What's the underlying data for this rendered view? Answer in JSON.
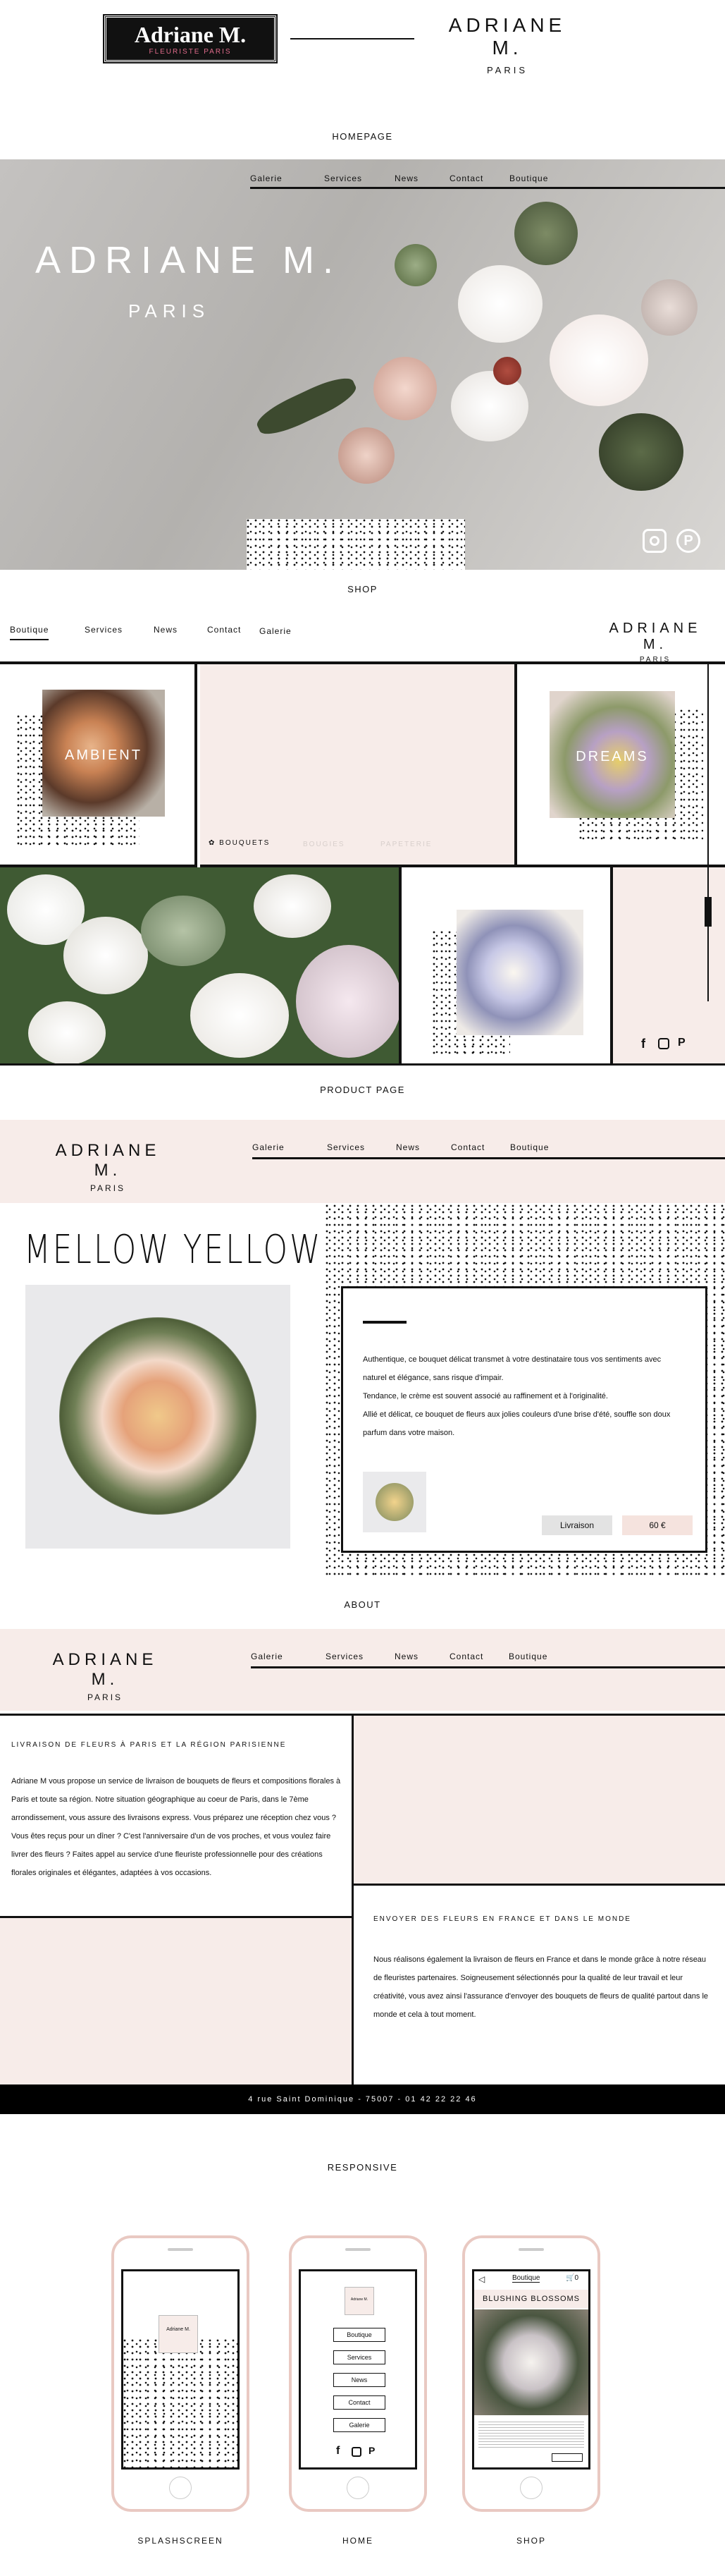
{
  "logos": {
    "left_main": "Adriane M.",
    "left_sub": "FLEURISTE PARIS",
    "right_main": "ADRIANE M.",
    "right_sub": "PARIS"
  },
  "sections": {
    "homepage": "HOMEPAGE",
    "shop": "SHOP",
    "product": "PRODUCT PAGE",
    "about": "ABOUT",
    "responsive": "RESPONSIVE"
  },
  "nav": {
    "items": [
      "Galerie",
      "Services",
      "News",
      "Contact",
      "Boutique"
    ]
  },
  "hero": {
    "title": "ADRIANE M.",
    "subtitle": "PARIS"
  },
  "shop": {
    "nav": [
      "Boutique",
      "Services",
      "News",
      "Contact",
      "Galerie"
    ],
    "tile_ambient": "AMBIENT",
    "tile_dreams": "DREAMS",
    "categories": [
      "BOUQUETS",
      "BOUGIES",
      "PAPETERIE"
    ]
  },
  "product": {
    "title": "MELLOW YELLOW",
    "desc1": "Authentique, ce bouquet délicat transmet à votre destinataire tous vos sentiments avec naturel et élégance, sans risque d'impair.",
    "desc2": "Tendance, le crème est souvent associé au raffinement et à l'originalité.",
    "desc3": "Allié et délicat, ce bouquet de fleurs aux jolies couleurs d'une brise d'été, souffle son doux parfum dans votre maison.",
    "delivery_label": "Livraison",
    "price": "60 €"
  },
  "about": {
    "heading1": "LIVRAISON DE FLEURS À PARIS ET LA RÉGION PARISIENNE",
    "para1": "Adriane M vous propose un service de livraison de bouquets de fleurs et compositions florales à Paris et toute sa région. Notre situation géographique au coeur de Paris, dans le 7ème arrondissement, vous assure des livraisons express. Vous préparez une réception chez vous ? Vous êtes reçus pour un dîner ? C'est l'anniversaire d'un de vos proches, et vous voulez faire livrer des fleurs ? Faites appel au service d'une fleuriste professionnelle pour des créations florales originales et élégantes, adaptées à vos occasions.",
    "heading2": "ENVOYER DES FLEURS EN FRANCE ET DANS LE MONDE",
    "para2": "Nous réalisons également la livraison de fleurs en France et dans le monde grâce à notre réseau de fleuristes partenaires. Soigneusement sélectionnés pour la qualité de leur travail et leur créativité, vous avez ainsi l'assurance d'envoyer des bouquets de fleurs de qualité partout dans le monde et cela à tout moment."
  },
  "footer": {
    "address": "4 rue Saint Dominique - 75007 - 01 42 22 22 46"
  },
  "responsive": {
    "captions": [
      "SPLASHSCREEN",
      "HOME",
      "SHOP"
    ],
    "phone_home_menu": [
      "Boutique",
      "Services",
      "News",
      "Contact",
      "Galerie"
    ],
    "phone_shop_tab": "Boutique",
    "phone_shop_title": "BLUSHING BLOSSOMS"
  },
  "colors": {
    "pink": "#f7ece9",
    "black": "#111111",
    "accent_pink": "#e9c9c2"
  }
}
